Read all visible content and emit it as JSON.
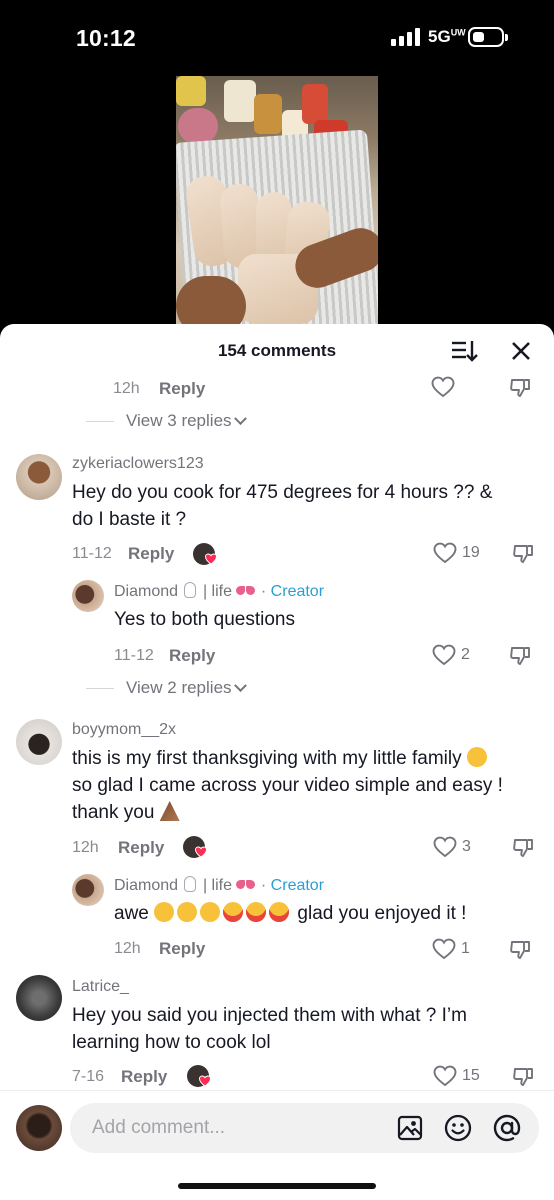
{
  "status": {
    "time": "10:12",
    "network": "5G",
    "network_sup": "UW"
  },
  "header": {
    "title": "154 comments"
  },
  "top_item": {
    "time": "12h",
    "reply": "Reply",
    "view_replies": "View 3 replies"
  },
  "comments": [
    {
      "username": "zykeriaclowers123",
      "text_line1": "Hey do you cook for 475 degrees for 4 hours ?? &",
      "text_line2": "do I baste it ?",
      "time": "11-12",
      "reply": "Reply",
      "likes": "19",
      "reply_item": {
        "author": "Diamond",
        "author_suffix": "| life",
        "creator_tag": "· Creator",
        "text": "Yes to both questions",
        "time": "11-12",
        "reply": "Reply",
        "likes": "2"
      },
      "view_replies": "View 2 replies"
    },
    {
      "username": "boyymom__2x",
      "text_line1": "this is my first thanksgiving with my little family",
      "text_line2": "so glad I came across your video simple and easy !",
      "text_line3": "thank you",
      "time": "12h",
      "reply": "Reply",
      "likes": "3",
      "reply_item": {
        "author": "Diamond",
        "author_suffix": "| life",
        "creator_tag": "· Creator",
        "text_prefix": "awe",
        "text": "glad you enjoyed it !",
        "time": "12h",
        "reply": "Reply",
        "likes": "1"
      }
    },
    {
      "username": "Latrice_",
      "text_line1": "Hey you said you injected them with what ? I’m",
      "text_line2": "learning how to cook lol",
      "time": "7-16",
      "reply": "Reply",
      "likes": "15"
    }
  ],
  "composer": {
    "placeholder": "Add comment..."
  },
  "icons": [
    "sort-icon",
    "close-icon",
    "heart-outline-icon",
    "dislike-icon",
    "image-icon",
    "emoji-icon",
    "mention-icon"
  ],
  "colors": {
    "creator_blue": "#2a9fd6",
    "muted_text": "#73747b",
    "ribbon_pink": "#e8618c",
    "liked_red": "#fe2c55"
  }
}
